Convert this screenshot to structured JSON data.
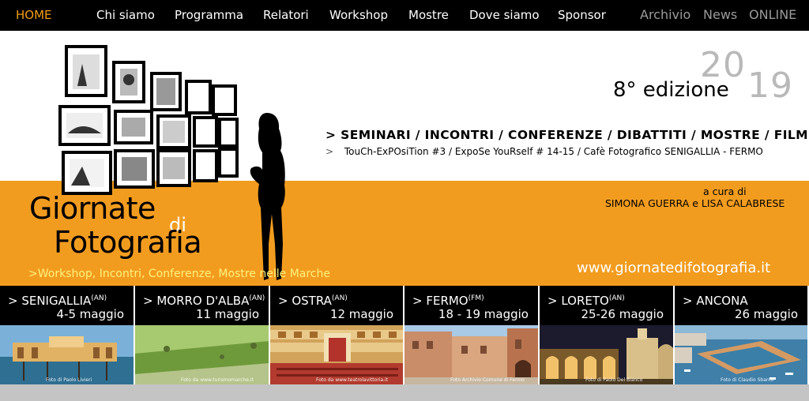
{
  "nav": {
    "home": "HOME",
    "items": [
      "Chi siamo",
      "Programma",
      "Relatori",
      "Workshop",
      "Mostre",
      "Dove siamo",
      "Sponsor"
    ],
    "right": [
      "Archivio",
      "News",
      "ONLINE"
    ]
  },
  "hero": {
    "year_a": "20",
    "year_b": "19",
    "edition": "8° edizione",
    "line1": ">   SEMINARI /  INCONTRI / CONFERENZE / DIBATTITI / MOSTRE / FILM",
    "line2_arrow": ">",
    "line2": "TouCh-ExPOsiTion #3  / ExpoSe YouRself # 14-15 / Cafè Fotografico SENIGALLIA - FERMO",
    "a_cura": "a cura di",
    "curators": "SIMONA GUERRA e LISA CALABRESE",
    "brand_line1": "Giornate",
    "brand_di": "di",
    "brand_line2": "Fotografia",
    "tagline": ">Workshop, Incontri, Conferenze, Mostre nelle Marche",
    "website": "www.giornatedifotografia.it"
  },
  "cities": [
    {
      "name": "> SENIGALLIA",
      "prov": "(AN)",
      "date": "4-5 maggio",
      "credit": "Foto di Paolo Livieri"
    },
    {
      "name": "> MORRO D'ALBA",
      "prov": "(AN)",
      "date": "11 maggio",
      "credit": "Foto da www.turismomarche.it"
    },
    {
      "name": "> OSTRA",
      "prov": "(AN)",
      "date": "12 maggio",
      "credit": "Foto da www.teatrolavittoria.it"
    },
    {
      "name": "> FERMO",
      "prov": "(FM)",
      "date": "18 - 19 maggio",
      "credit": "Foto Archivio Comune di Fermo"
    },
    {
      "name": "> LORETO",
      "prov": "(AN)",
      "date": "25-26 maggio",
      "credit": "Foto di Paolo Del Bianco"
    },
    {
      "name": "> ANCONA",
      "prov": "",
      "date": "26 maggio",
      "credit": "Foto di Claudio Sbarco"
    }
  ],
  "colors": {
    "orange": "#f29c1f",
    "home": "#f39c12",
    "tagline": "#fff27a",
    "nav_bg": "#000000"
  }
}
